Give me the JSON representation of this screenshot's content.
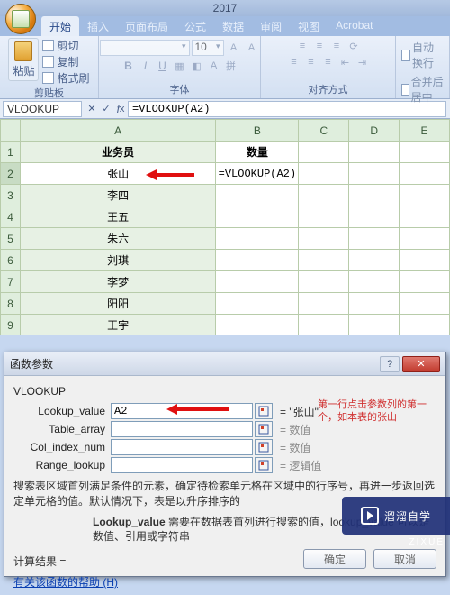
{
  "title_year": "2017",
  "tabs": [
    "开始",
    "插入",
    "页面布局",
    "公式",
    "数据",
    "审阅",
    "视图",
    "Acrobat"
  ],
  "active_tab_index": 0,
  "ribbon": {
    "paste_label": "粘贴",
    "cut": "剪切",
    "copy": "复制",
    "format_painter": "格式刷",
    "group_clipboard": "剪贴板",
    "font_name": "",
    "font_size": "10",
    "group_font": "字体",
    "wrap_text": "自动换行",
    "merge_center": "合并后居中",
    "group_align": "对齐方式"
  },
  "name_box": "VLOOKUP",
  "formula_bar": "=VLOOKUP(A2)",
  "columns": [
    "A",
    "B",
    "C",
    "D",
    "E"
  ],
  "header_row": {
    "A": "业务员",
    "B": "数量"
  },
  "rows": [
    {
      "n": 1
    },
    {
      "n": 2,
      "A": "张山",
      "B": "=VLOOKUP(A2)",
      "selected": true,
      "active_b": true
    },
    {
      "n": 3,
      "A": "李四"
    },
    {
      "n": 4,
      "A": "王五"
    },
    {
      "n": 5,
      "A": "朱六"
    },
    {
      "n": 6,
      "A": "刘琪"
    },
    {
      "n": 7,
      "A": "李梦"
    },
    {
      "n": 8,
      "A": "阳阳"
    },
    {
      "n": 9,
      "A": "王宇"
    }
  ],
  "dialog": {
    "title": "函数参数",
    "function": "VLOOKUP",
    "params": {
      "lookup_value": {
        "label": "Lookup_value",
        "value": "A2",
        "result": "= \"张山\""
      },
      "table_array": {
        "label": "Table_array",
        "value": "",
        "result": "= 数值"
      },
      "col_index_num": {
        "label": "Col_index_num",
        "value": "",
        "result": "= 数值"
      },
      "range_lookup": {
        "label": "Range_lookup",
        "value": "",
        "result": "= 逻辑值"
      }
    },
    "side_note": "第一行点击参数列的第一个，如本表的张山",
    "desc": "搜索表区域首列满足条件的元素，确定待检索单元格在区域中的行序号，再进一步返回选定单元格的值。默认情况下，表是以升序排序的",
    "desc_sub_label": "Lookup_value",
    "desc_sub": "需要在数据表首列进行搜索的值，lookup_value 可以是数值、引用或字符串",
    "calc_label": "计算结果 =",
    "help": "有关该函数的帮助 (H)",
    "ok": "确定",
    "cancel": "取消"
  },
  "watermark": {
    "brand": "溜溜自学",
    "sub": "ZIXUE"
  }
}
